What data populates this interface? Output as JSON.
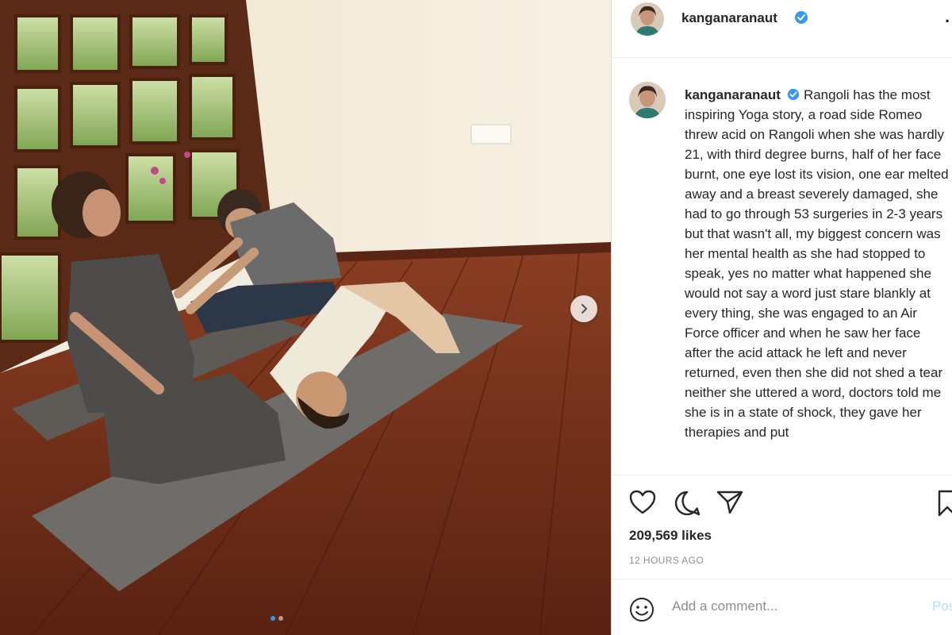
{
  "post": {
    "username": "kanganaranaut",
    "verified": true,
    "caption": "Rangoli has the most inspiring Yoga story, a road side Romeo threw acid on Rangoli when she was hardly 21, with third degree burns, half of her face burnt, one eye lost its vision, one ear melted away and a breast severely damaged, she had to go through 53 surgeries in 2-3 years but that wasn't all, my biggest concern was her mental health as she had stopped to speak, yes no matter what happened she would not say a word just stare blankly at every thing, she was engaged to an Air Force officer and when he saw her face after the acid attack he left and never returned, even then she did not shed a tear neither she uttered a word, doctors told me she is in a state of shock, they gave her therapies and put",
    "likes": "209,569 likes",
    "time_ago": "12 HOURS AGO",
    "more_label": "···",
    "carousel": {
      "count": 2,
      "active_index": 0
    }
  },
  "comment": {
    "placeholder": "Add a comment...",
    "post_label": "Post"
  },
  "icons": {
    "next": "chevron-right-icon",
    "like": "heart-icon",
    "comment": "comment-icon",
    "share": "paper-plane-icon",
    "save": "bookmark-icon",
    "emoji": "smiley-icon",
    "verified": "verified-badge-icon"
  },
  "colors": {
    "verified": "#3897f0",
    "text": "#262626",
    "secondary": "#8e8e8e",
    "post_disabled": "#b2dffc",
    "border": "#dbdbdb"
  }
}
